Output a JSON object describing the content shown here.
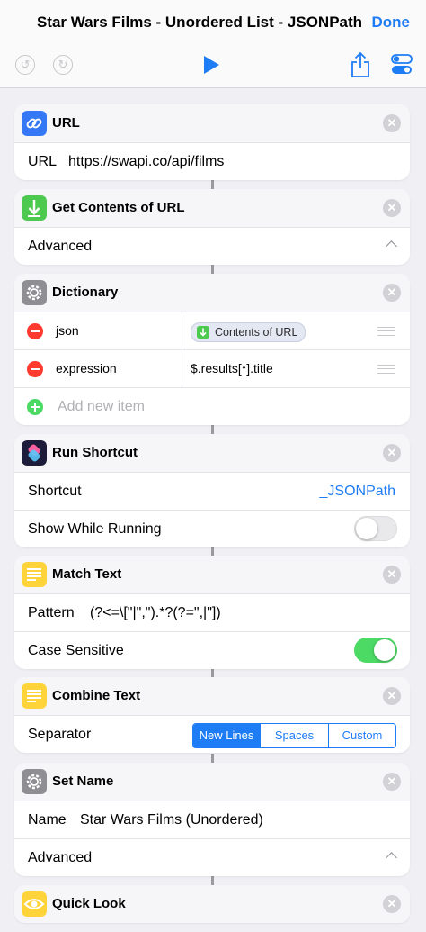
{
  "nav": {
    "title": "Star Wars Films - Unordered List - JSONPath",
    "done": "Done"
  },
  "toolbar": {
    "undo_icon": "undo-icon",
    "redo_icon": "redo-icon",
    "play_icon": "play-icon",
    "share_icon": "share-icon",
    "settings_icon": "toggles-icon"
  },
  "colors": {
    "accent": "#1e7cf5",
    "green": "#4cd964",
    "red": "#ff3b30"
  },
  "actions": {
    "url": {
      "title": "URL",
      "label": "URL",
      "value": "https://swapi.co/api/films"
    },
    "get_contents": {
      "title": "Get Contents of URL",
      "advanced": "Advanced"
    },
    "dictionary": {
      "title": "Dictionary",
      "items": [
        {
          "key": "json",
          "value": "Contents of URL"
        },
        {
          "key": "expression",
          "value": "$.results[*].title"
        }
      ],
      "add_placeholder": "Add new item"
    },
    "run_shortcut": {
      "title": "Run Shortcut",
      "shortcut_label": "Shortcut",
      "shortcut_value": "_JSONPath",
      "show_label": "Show While Running",
      "show_on": false
    },
    "match_text": {
      "title": "Match Text",
      "pattern_label": "Pattern",
      "pattern_value": "(?<=\\[\"|\",\").*?(?=\",|\"])",
      "case_label": "Case Sensitive",
      "case_on": true
    },
    "combine_text": {
      "title": "Combine Text",
      "separator_label": "Separator",
      "options": [
        "New Lines",
        "Spaces",
        "Custom"
      ],
      "selected": "New Lines"
    },
    "set_name": {
      "title": "Set Name",
      "name_label": "Name",
      "name_value": "Star Wars Films (Unordered)",
      "advanced": "Advanced"
    },
    "quick_look": {
      "title": "Quick Look"
    }
  }
}
